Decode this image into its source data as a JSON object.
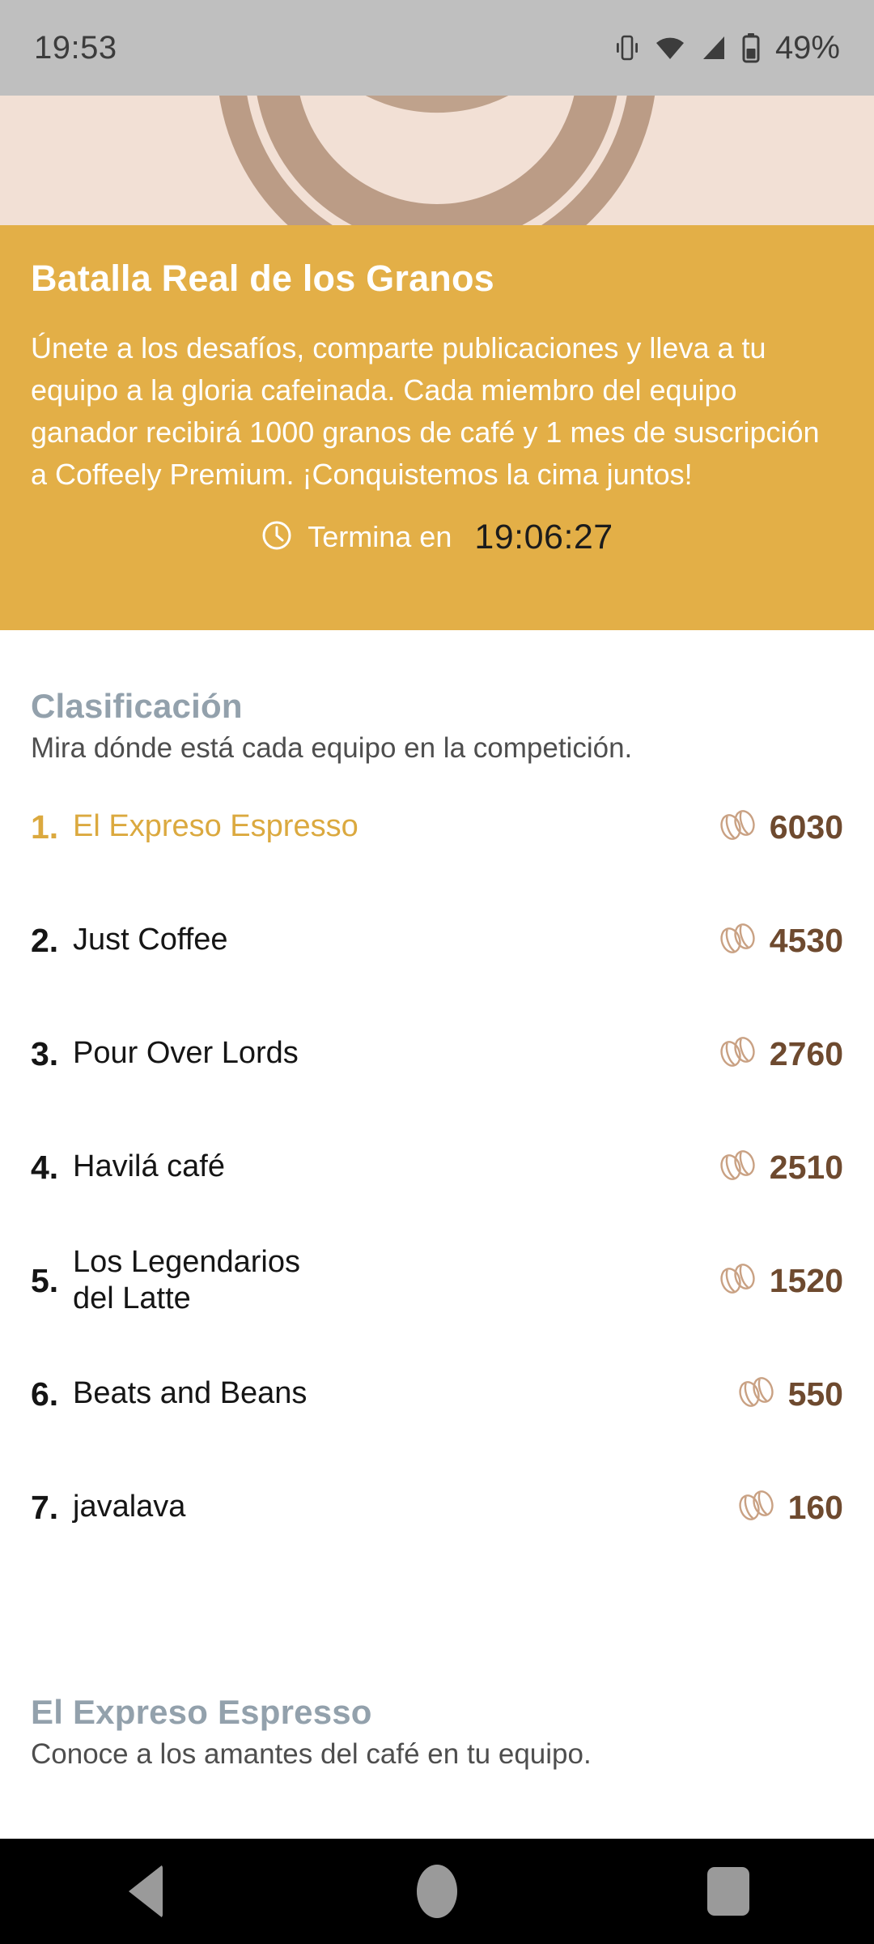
{
  "status_bar": {
    "time": "19:53",
    "battery_percent": "49%",
    "icons": [
      "vibrate-icon",
      "wifi-icon",
      "cellular-signal-icon",
      "battery-icon"
    ]
  },
  "hero": {
    "image_alt": "coffee-cup-illustration",
    "background_color": "#f2e0d5",
    "art_color": "#bb9c86"
  },
  "banner": {
    "background_color": "#e3af47",
    "title": "Batalla Real de los Granos",
    "description": "Únete a los desafíos, comparte publicaciones y lleva a tu equipo a la gloria cafeinada. Cada miembro del equipo ganador recibirá 1000 granos de café y 1 mes de suscripción a Coffeely Premium. ¡Conquistemos la cima juntos!",
    "countdown_label": "Termina en",
    "countdown_value": "19:06:27",
    "clock_icon": "clock-icon"
  },
  "leaderboard": {
    "title": "Clasificación",
    "subtitle": "Mira dónde está cada equipo en la competición.",
    "leader_color": "#dba93f",
    "score_color": "#6e4a2f",
    "bean_icon": "coffee-beans-icon",
    "rows": [
      {
        "rank": "1.",
        "team": "El Expreso Espresso",
        "score": "6030"
      },
      {
        "rank": "2.",
        "team": "Just Coffee",
        "score": "4530"
      },
      {
        "rank": "3.",
        "team": "Pour Over Lords",
        "score": "2760"
      },
      {
        "rank": "4.",
        "team": "Havilá café",
        "score": "2510"
      },
      {
        "rank": "5.",
        "team": "Los Legendarios del Latte",
        "score": "1520"
      },
      {
        "rank": "6.",
        "team": "Beats and Beans",
        "score": "550"
      },
      {
        "rank": "7.",
        "team": "javalava",
        "score": "160"
      }
    ]
  },
  "team_section": {
    "title": "El Expreso Espresso",
    "subtitle": "Conoce a los amantes del café en tu equipo."
  },
  "nav_bar": {
    "back": "back-button",
    "home": "home-button",
    "recents": "recents-button"
  }
}
